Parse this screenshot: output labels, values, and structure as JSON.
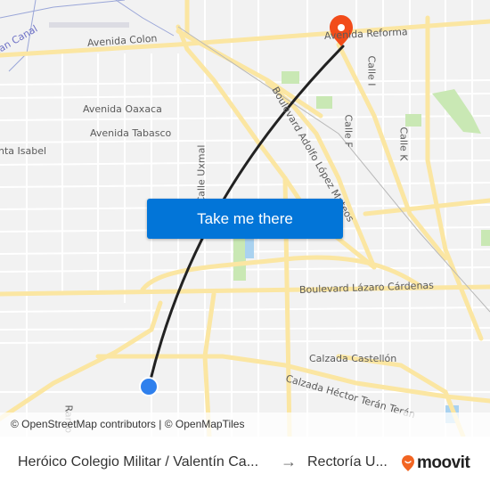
{
  "map": {
    "street_labels": [
      {
        "id": "avenida-colon",
        "text": "Avenida Colon"
      },
      {
        "id": "avenida-reforma",
        "text": "Avenida Reforma"
      },
      {
        "id": "canal",
        "text": "can Canal"
      },
      {
        "id": "avenida-oaxaca",
        "text": "Avenida Oaxaca"
      },
      {
        "id": "avenida-tabasco",
        "text": "Avenida Tabasco"
      },
      {
        "id": "santa-isabel",
        "text": "nta Isabel"
      },
      {
        "id": "calle-uxmal",
        "text": "Calle Uxmal"
      },
      {
        "id": "boulevard-lopez-mateos",
        "text": "Boulevard Adolfo López Mateos"
      },
      {
        "id": "calle-i",
        "text": "Calle I"
      },
      {
        "id": "calle-f",
        "text": "Calle F"
      },
      {
        "id": "calle-k",
        "text": "Calle K"
      },
      {
        "id": "boulevard-lazaro-cardenas",
        "text": "Boulevard Lázaro Cárdenas"
      },
      {
        "id": "calzada-castellon",
        "text": "Calzada Castellón"
      },
      {
        "id": "calzada-hector-teran",
        "text": "Calzada Héctor Terán Terán"
      },
      {
        "id": "ramo",
        "text": "Ramo"
      }
    ],
    "colors": {
      "route": "#222222",
      "origin_marker": "#2f80ed",
      "destination_marker": "#f24c1a",
      "major_road": "#fbe6a2",
      "park": "#c9e8b4",
      "water": "#a9d2f0"
    },
    "attribution": "© OpenStreetMap contributors | © OpenMapTiles"
  },
  "cta": {
    "label": "Take me there"
  },
  "footer": {
    "from": "Heróico Colegio Militar / Valentín Ca...",
    "arrow": "→",
    "to": "Rectoría U...",
    "brand": "moovit",
    "brand_color": "#f26522"
  }
}
